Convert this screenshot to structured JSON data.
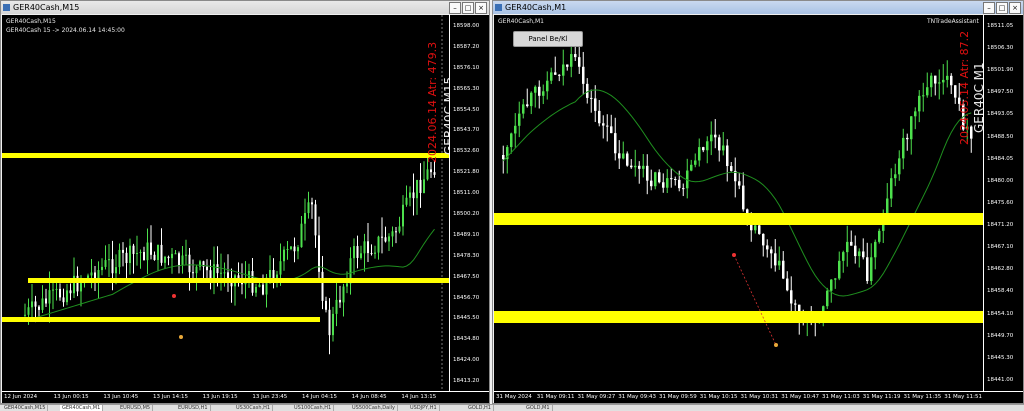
{
  "left_window": {
    "title": "GER40Cash,M15",
    "chart_header": "GER40Cash,M15",
    "info_line": "GER40Cash 15 -> 2024.06.14 14:45:00",
    "vertical_red": "2024.06.14 Atr: 479.3",
    "vertical_white": "GER40C M15",
    "y_labels": [
      "18598.00",
      "18587.20",
      "18576.10",
      "18565.30",
      "18554.50",
      "18543.70",
      "18532.60",
      "18521.80",
      "18511.00",
      "18500.20",
      "18489.10",
      "18478.30",
      "18467.50",
      "18456.70",
      "18445.50",
      "18434.80",
      "18424.00",
      "18413.20"
    ],
    "x_labels": [
      "12 Jun 2024",
      "13 Jun 00:15",
      "13 Jun 10:45",
      "13 Jun 14:15",
      "13 Jun 19:15",
      "13 Jun 23:45",
      "14 Jun 04:15",
      "14 Jun 08:45",
      "14 Jun 13:15"
    ]
  },
  "right_window": {
    "title": "GER40Cash,M1",
    "chart_header": "GER40Cash,M1",
    "indicator_name": "TNTradeAssistant",
    "panel_button": "Panel Be/Kl",
    "vertical_red": "2024.05.14 Atr: 87.2",
    "vertical_white": "GER40C M1",
    "y_labels": [
      "18511.05",
      "18506.30",
      "18501.90",
      "18497.50",
      "18493.05",
      "18488.50",
      "18484.05",
      "18480.00",
      "18475.60",
      "18471.20",
      "18467.10",
      "18462.80",
      "18458.40",
      "18454.10",
      "18449.70",
      "18445.30",
      "18441.00"
    ],
    "x_labels": [
      "31 May 2024",
      "31 May 09:11",
      "31 May 09:27",
      "31 May 09:43",
      "31 May 09:59",
      "31 May 10:15",
      "31 May 10:31",
      "31 May 10:47",
      "31 May 11:03",
      "31 May 11:19",
      "31 May 11:35",
      "31 May 11:51"
    ]
  },
  "tabs": [
    "GER40Cash,M15",
    "GER40Cash,M1",
    "EURUSD,M5",
    "EURUSD,H1",
    "US30Cash,H1",
    "US100Cash,H1",
    "US500Cash,Daily",
    "USDJPY,H1",
    "GOLD,H1",
    "GOLD,M1"
  ],
  "colors": {
    "bull": "#4de04d",
    "bear": "#ffffff",
    "level": "#ffff00",
    "ma": "#1f8f1f",
    "red_text": "#e01010"
  }
}
